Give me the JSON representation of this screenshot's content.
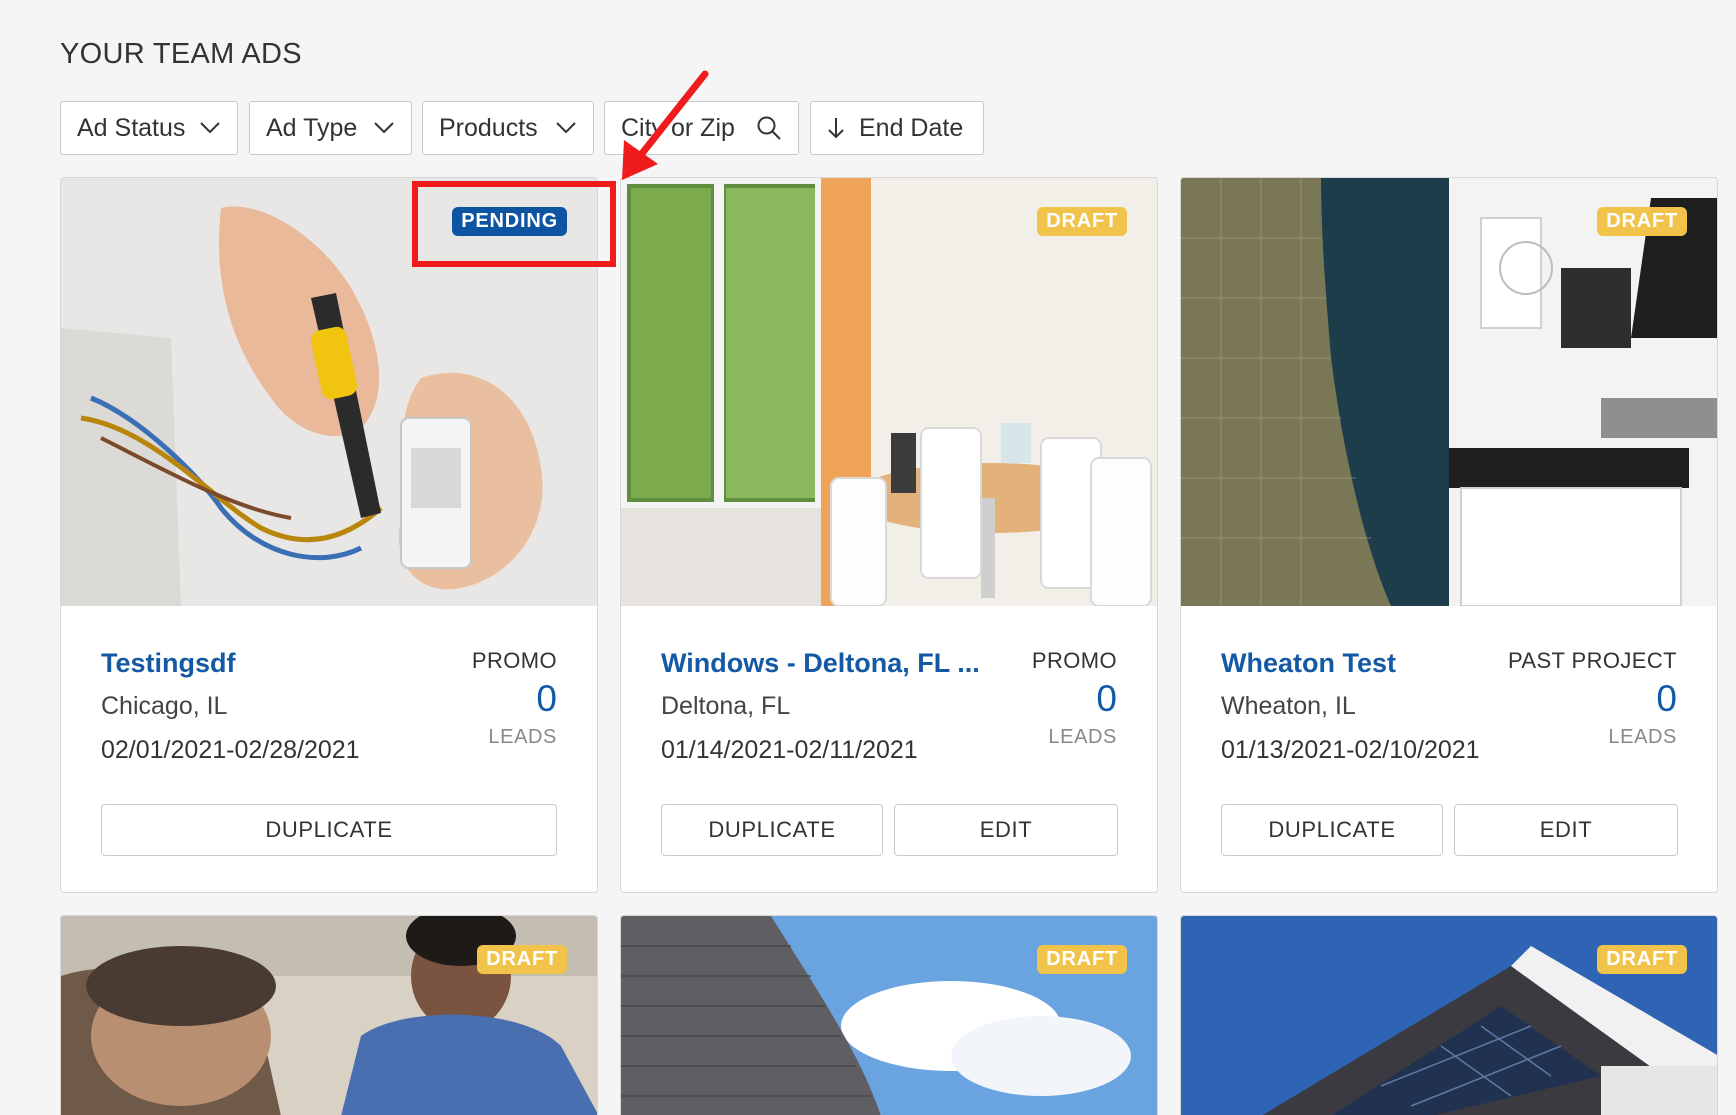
{
  "page": {
    "title": "YOUR TEAM ADS"
  },
  "filters": {
    "ad_status": "Ad Status",
    "ad_type": "Ad Type",
    "products": "Products",
    "search_placeholder": "City or Zip",
    "sort": "End Date"
  },
  "cards": [
    {
      "badge": "PENDING",
      "title": "Testingsdf",
      "type": "PROMO",
      "location": "Chicago, IL",
      "dates": "02/01/2021-02/28/2021",
      "leads": "0",
      "leads_label": "LEADS",
      "duplicate": "DUPLICATE"
    },
    {
      "badge": "DRAFT",
      "title": "Windows - Deltona, FL ...",
      "type": "PROMO",
      "location": "Deltona, FL",
      "dates": "01/14/2021-02/11/2021",
      "leads": "0",
      "leads_label": "LEADS",
      "duplicate": "DUPLICATE",
      "edit": "EDIT"
    },
    {
      "badge": "DRAFT",
      "title": "Wheaton Test",
      "type": "PAST PROJECT",
      "location": "Wheaton, IL",
      "dates": "01/13/2021-02/10/2021",
      "leads": "0",
      "leads_label": "LEADS",
      "duplicate": "DUPLICATE",
      "edit": "EDIT"
    },
    {
      "badge": "DRAFT"
    },
    {
      "badge": "DRAFT"
    },
    {
      "badge": "DRAFT"
    }
  ],
  "colors": {
    "accent_blue": "#1459a4",
    "pending_badge": "#0d55a3",
    "draft_badge": "#f2c34a",
    "annotation_red": "#ee1c1c"
  }
}
